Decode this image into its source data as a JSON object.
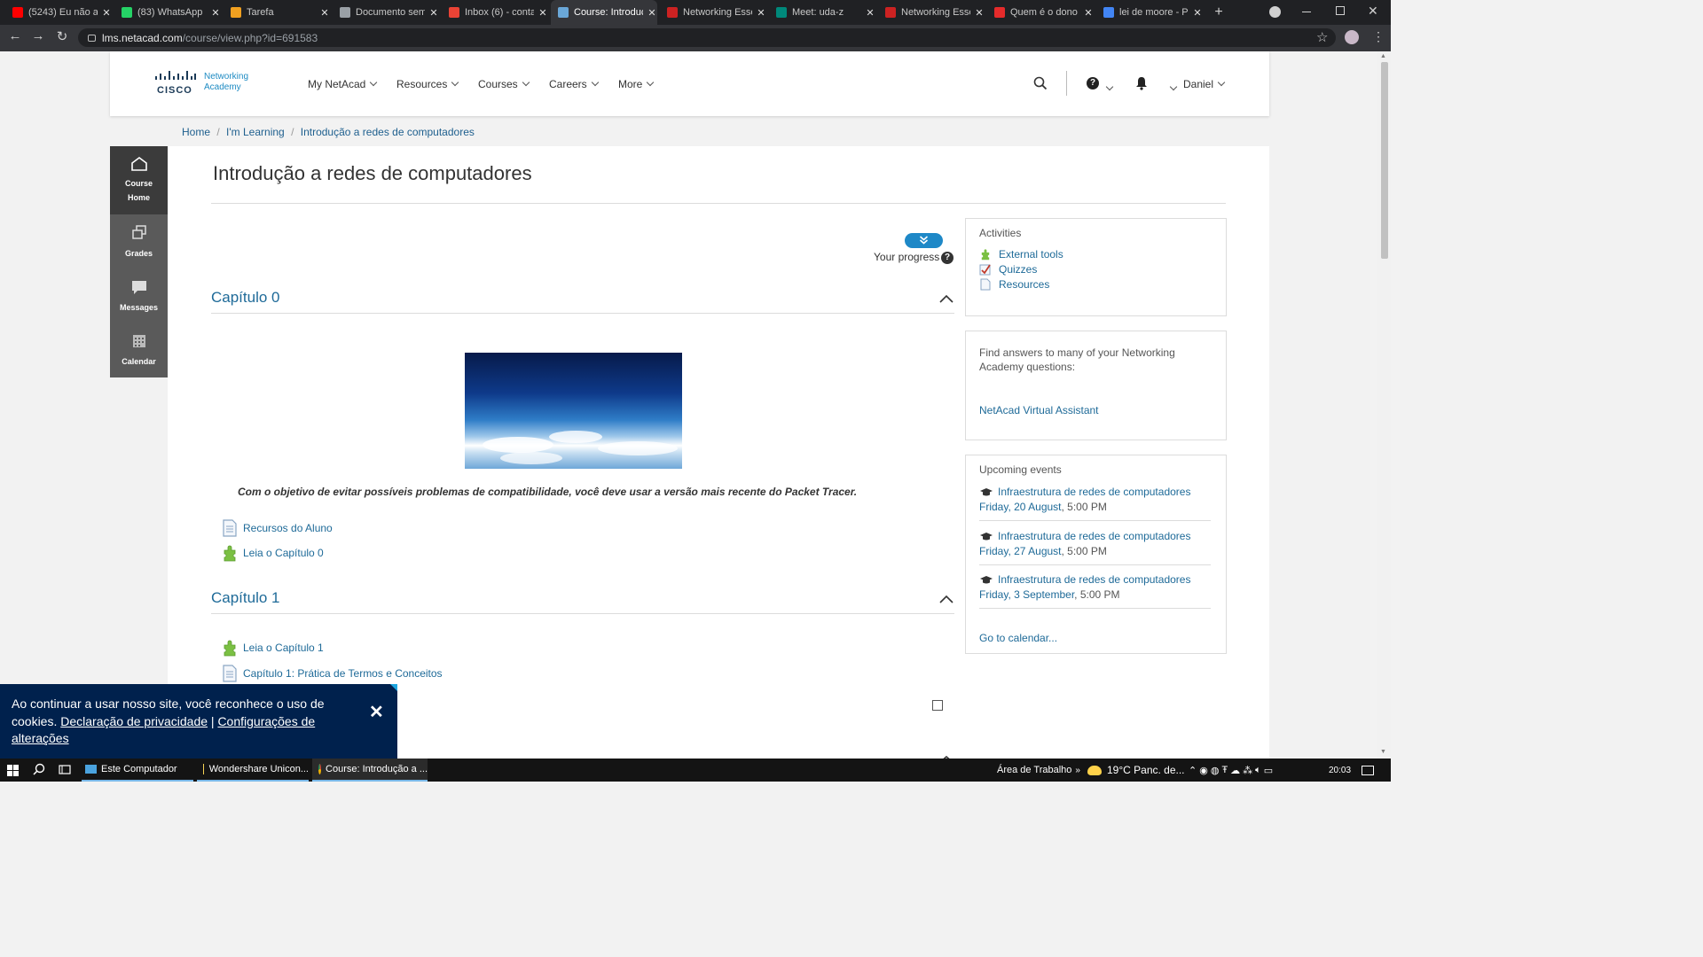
{
  "browser": {
    "tabs": [
      {
        "title": "(5243) Eu não ac",
        "favicon": "youtube-icon",
        "color": "#ff0000",
        "active": false
      },
      {
        "title": "(83) WhatsApp",
        "favicon": "whatsapp-icon",
        "color": "#25d366",
        "active": false
      },
      {
        "title": "Tarefa",
        "favicon": "tarefa-icon",
        "color": "#f0a020",
        "active": false
      },
      {
        "title": "Documento sem",
        "favicon": "globe-icon",
        "color": "#9aa0a6",
        "active": false
      },
      {
        "title": "Inbox (6) - conta",
        "favicon": "gmail-icon",
        "color": "#ea4335",
        "active": false
      },
      {
        "title": "Course: Introduç",
        "favicon": "cisco-icon",
        "color": "#6aa7d8",
        "active": true
      },
      {
        "title": "Networking Esse",
        "favicon": "cisco-icon",
        "color": "#cc2222",
        "active": false
      },
      {
        "title": "Meet: uda-z",
        "favicon": "meet-icon",
        "color": "#00897b",
        "active": false
      },
      {
        "title": "Networking Esse",
        "favicon": "cisco-icon",
        "color": "#cc2222",
        "active": false
      },
      {
        "title": "Quem é o dono",
        "favicon": "s-icon",
        "color": "#e52b2b",
        "active": false
      },
      {
        "title": "lei de moore - P",
        "favicon": "google-icon",
        "color": "#4285f4",
        "active": false
      }
    ],
    "new_tab": "+",
    "url_domain": "lms.netacad.com",
    "url_path": "/course/view.php?id=691583"
  },
  "header": {
    "logo_cisco": "CISCO",
    "logo_networking": "Networking",
    "logo_academy": "Academy",
    "menu": [
      "My NetAcad",
      "Resources",
      "Courses",
      "Careers",
      "More"
    ],
    "user": "Daniel"
  },
  "breadcrumb": [
    "Home",
    "I'm Learning",
    "Introdução a redes de computadores"
  ],
  "leftnav": [
    {
      "label1": "Course",
      "label2": "Home",
      "icon": "home-icon"
    },
    {
      "label1": "Grades",
      "label2": "",
      "icon": "grades-icon"
    },
    {
      "label1": "Messages",
      "label2": "",
      "icon": "messages-icon"
    },
    {
      "label1": "Calendar",
      "label2": "",
      "icon": "calendar-icon"
    }
  ],
  "course": {
    "title": "Introdução a redes de computadores",
    "progress_label": "Your progress",
    "chapter0": {
      "title": "Capítulo 0",
      "notice": "Com o objetivo de evitar possíveis problemas de compatibilidade, você deve usar a versão mais recente do Packet Tracer.",
      "items": [
        "Recursos do Aluno",
        "Leia o Capítulo 0"
      ]
    },
    "chapter1": {
      "title": "Capítulo 1",
      "items": [
        "Leia o Capítulo 1",
        "Capítulo 1: Prática de Termos e Conceitos"
      ]
    }
  },
  "activities": {
    "title": "Activities",
    "items": [
      "External tools",
      "Quizzes",
      "Resources"
    ]
  },
  "help": {
    "text": "Find answers to many of your Networking Academy questions:",
    "link": "NetAcad Virtual Assistant"
  },
  "events": {
    "title": "Upcoming events",
    "items": [
      {
        "name": "Infraestrutura de redes de computadores",
        "date": "Friday, 20 August",
        "time": ", 5:00 PM"
      },
      {
        "name": "Infraestrutura de redes de computadores",
        "date": "Friday, 27 August",
        "time": ", 5:00 PM"
      },
      {
        "name": "Infraestrutura de redes de computadores",
        "date": "Friday, 3 September",
        "time": ", 5:00 PM"
      }
    ],
    "calendar_link": "Go to calendar..."
  },
  "cookie": {
    "text": "Ao continuar a usar nosso site, você reconhece o uso de cookies.",
    "privacy_link": "Declaração de privacidade",
    "separator": "|",
    "settings_link": "Configurações de alterações",
    "close": "✕"
  },
  "taskbar": {
    "items": [
      "Este Computador",
      "Wondershare Unicon...",
      "Course: Introdução a ..."
    ],
    "desktop": "Área de Trabalho",
    "weather": "19°C  Panc. de...",
    "time": "20:03"
  }
}
